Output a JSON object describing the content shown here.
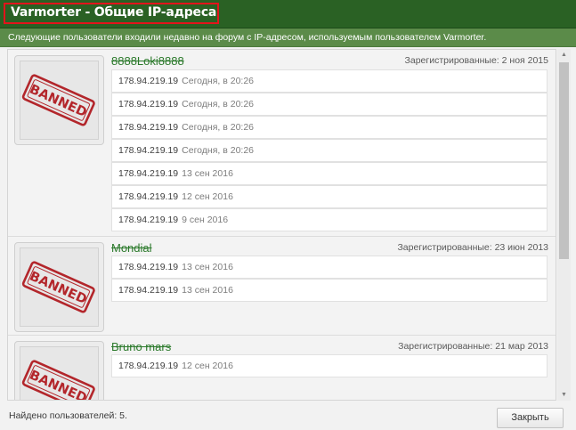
{
  "dialog": {
    "title": "Varmorter - Общие IP-адреса",
    "description": "Следующие пользователи входили недавно на форум с IP-адресом, используемым пользователем Varmorter."
  },
  "users": [
    {
      "name": "8888Loki8888",
      "registered": "Зарегистрированные: 2 ноя 2015",
      "avatar_stamp": "BANNED",
      "ips": [
        {
          "ip": "178.94.219.19",
          "date": "Сегодня, в 20:26"
        },
        {
          "ip": "178.94.219.19",
          "date": "Сегодня, в 20:26"
        },
        {
          "ip": "178.94.219.19",
          "date": "Сегодня, в 20:26"
        },
        {
          "ip": "178.94.219.19",
          "date": "Сегодня, в 20:26"
        },
        {
          "ip": "178.94.219.19",
          "date": "13 сен 2016"
        },
        {
          "ip": "178.94.219.19",
          "date": "12 сен 2016"
        },
        {
          "ip": "178.94.219.19",
          "date": "9 сен 2016"
        }
      ]
    },
    {
      "name": "Mondial",
      "registered": "Зарегистрированные: 23 июн 2013",
      "avatar_stamp": "BANNED",
      "ips": [
        {
          "ip": "178.94.219.19",
          "date": "13 сен 2016"
        },
        {
          "ip": "178.94.219.19",
          "date": "13 сен 2016"
        }
      ]
    },
    {
      "name": "Bruno mars",
      "registered": "Зарегистрированные: 21 мар 2013",
      "avatar_stamp": "BANNED",
      "ips": [
        {
          "ip": "178.94.219.19",
          "date": "12 сен 2016"
        }
      ]
    }
  ],
  "footer": {
    "found": "Найдено пользователей: 5.",
    "close_label": "Закрыть"
  },
  "colors": {
    "title_bar": "#2a6124",
    "info_bar": "#5b8b49",
    "title_highlight": "#e3141b",
    "username": "#2c7a2c",
    "stamp": "#b3262b"
  }
}
